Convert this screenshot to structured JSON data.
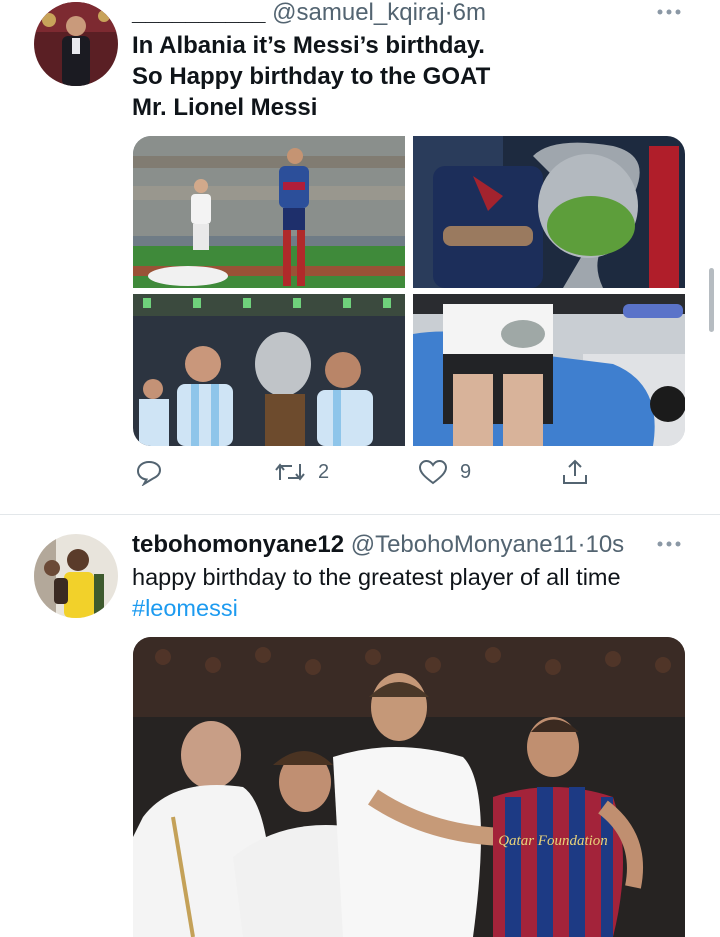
{
  "tweets": [
    {
      "display_name": "__________",
      "handle": "@samuel_kqiraj",
      "separator": "·",
      "time": "6m",
      "more_icon": "more-horizontal-icon",
      "text_lines": [
        "In Albania it’s Messi’s birthday.",
        "So Happy birthday to the GOAT",
        "Mr. Lionel Messi"
      ],
      "media": [
        "Messi in Barcelona kit dribbling past Real Madrid players",
        "Messi holding the Champions League trophy",
        "Argentina players celebrating with the Copa América trophy",
        "Seated figure holding a pair of boots in a race car"
      ],
      "actions": {
        "reply_icon": "reply-icon",
        "retweet_icon": "retweet-icon",
        "retweet_count": "2",
        "like_icon": "heart-icon",
        "like_count": "9",
        "share_icon": "share-icon"
      }
    },
    {
      "display_name": "tebohomonyane12",
      "handle": "@TebohoMonyane11",
      "separator": "·",
      "time": "10s",
      "more_icon": "more-horizontal-icon",
      "text_line_1": "happy birthday to the greatest player of all time",
      "hashtag": "#leomessi",
      "media_caption": "Messi in Barcelona kit surrounded by Real Madrid players",
      "shirt_text": "Qatar Foundation"
    }
  ],
  "colors": {
    "text": "#0f1419",
    "secondary": "#536471",
    "link": "#1d9bf0",
    "divider": "#e3e7ea"
  }
}
